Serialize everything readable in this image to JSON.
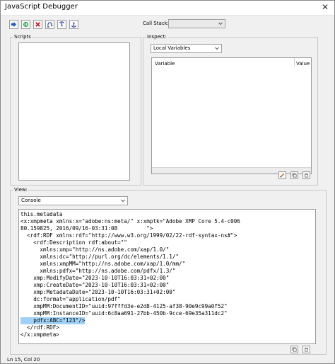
{
  "window": {
    "title": "JavaScript Debugger"
  },
  "toolbar": {
    "buttons": [
      {
        "icon": "resume-icon"
      },
      {
        "icon": "pause-icon"
      },
      {
        "icon": "stop-icon"
      },
      {
        "icon": "step-over-icon"
      },
      {
        "icon": "step-into-icon"
      },
      {
        "icon": "step-out-icon"
      }
    ]
  },
  "call_stack": {
    "label": "Call Stack:",
    "value": ""
  },
  "scripts": {
    "label": "Scripts"
  },
  "inspect": {
    "label": "Inspect:",
    "selected": "Local Variables",
    "columns": [
      "Variable",
      "Value"
    ]
  },
  "view": {
    "label": "View:",
    "selected": "Console"
  },
  "console": {
    "lines": [
      "this.metadata",
      "<x:xmpmeta xmlns:x=\"adobe:ns:meta/\" x:xmptk=\"Adobe XMP Core 5.4-c006",
      "80.159825, 2016/09/16-03:31:08         \">",
      "  <rdf:RDF xmlns:rdf=\"http://www.w3.org/1999/02/22-rdf-syntax-ns#\">",
      "    <rdf:Description rdf:about=\"\"",
      "      xmlns:xmp=\"http://ns.adobe.com/xap/1.0/\"",
      "      xmlns:dc=\"http://purl.org/dc/elements/1.1/\"",
      "      xmlns:xmpMM=\"http://ns.adobe.com/xap/1.0/mm/\"",
      "      xmlns:pdfx=\"http://ns.adobe.com/pdfx/1.3/\"",
      "    xmp:ModifyDate=\"2023-10-10T16:03:31+02:00\"",
      "    xmp:CreateDate=\"2023-10-10T16:03:31+02:00\"",
      "    xmp:MetadataDate=\"2023-10-10T16:03:31+02:00\"",
      "    dc:format=\"application/pdf\"",
      "    xmpMM:DocumentID=\"uuid:97fffd3e-e2d8-4125-af38-90e9c99a0f52\"",
      "    xmpMM:InstanceID=\"uuid:6c8aa691-27bb-450b-9cce-69e35a311dc2\"",
      "    pdfx:ABC=\"123\"/>",
      "  </rdf:RDF>",
      "</x:xmpmeta>"
    ],
    "selected_line_index": 15
  },
  "status": {
    "position": "Ln 15, Col 20"
  }
}
